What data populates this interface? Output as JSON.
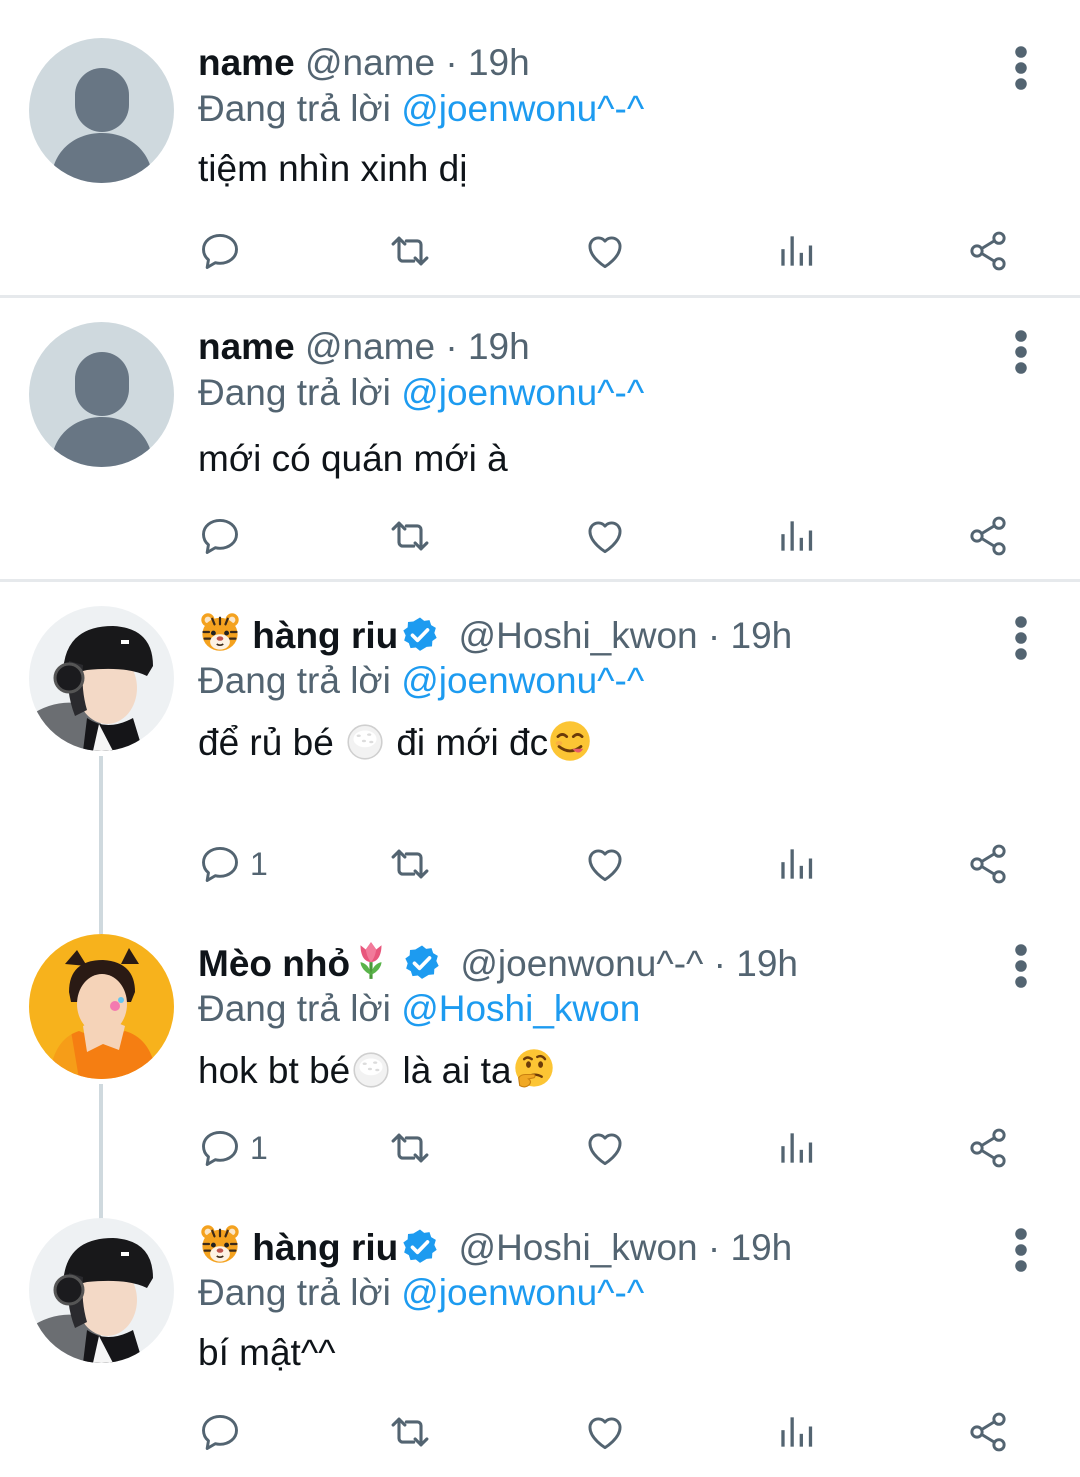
{
  "tweets": [
    {
      "display_name": "name",
      "handle": "@name",
      "time": "19h",
      "separator": "·",
      "reply_prefix": "Đang trả lời",
      "reply_to": "@joenwonu^-^",
      "text": "tiệm nhìn xinh dị",
      "reply_count": "",
      "avatar": "default-avatar",
      "verified": false
    },
    {
      "display_name": "name",
      "handle": "@name",
      "time": "19h",
      "separator": "·",
      "reply_prefix": "Đang trả lời",
      "reply_to": "@joenwonu^-^",
      "text": "mới có quán mới à",
      "reply_count": "",
      "avatar": "default-avatar",
      "verified": false
    },
    {
      "display_name": "hàng riu",
      "name_emoji": "tiger-face-emoji",
      "handle": "@Hoshi_kwon",
      "time": "19h",
      "separator": "·",
      "reply_prefix": "Đang trả lời",
      "reply_to": "@joenwonu^-^",
      "text_part1": "để rủ bé ",
      "text_part2": " đi mới đc",
      "text_emojis": [
        "rice-ball-emoji",
        "face-savoring-food-emoji"
      ],
      "reply_count": "1",
      "avatar": "black-beanie-headphones-photo",
      "verified": true
    },
    {
      "display_name": "Mèo nhỏ",
      "name_emoji": "tulip-emoji",
      "handle": "@joenwonu^-^",
      "time": "19h",
      "separator": "·",
      "reply_prefix": "Đang trả lời",
      "reply_to": "@Hoshi_kwon",
      "text_part1": "hok bt bé",
      "text_part2": " là ai ta",
      "text_emojis": [
        "rice-ball-emoji",
        "thinking-face-emoji"
      ],
      "reply_count": "1",
      "avatar": "orange-background-cat-ears-photo",
      "verified": true
    },
    {
      "display_name": "hàng riu",
      "name_emoji": "tiger-face-emoji",
      "handle": "@Hoshi_kwon",
      "time": "19h",
      "separator": "·",
      "reply_prefix": "Đang trả lời",
      "reply_to": "@joenwonu^-^",
      "text": "bí mật^^",
      "reply_count": "",
      "avatar": "black-beanie-headphones-photo",
      "verified": true
    }
  ],
  "colors": {
    "accent": "#1d9bf0",
    "secondary_text": "#536471",
    "icon": "#536471",
    "divider": "#e6e9ec",
    "thread_line": "#cfd9de"
  },
  "actions": [
    "reply-icon",
    "retweet-icon",
    "like-icon",
    "views-icon",
    "share-icon"
  ]
}
